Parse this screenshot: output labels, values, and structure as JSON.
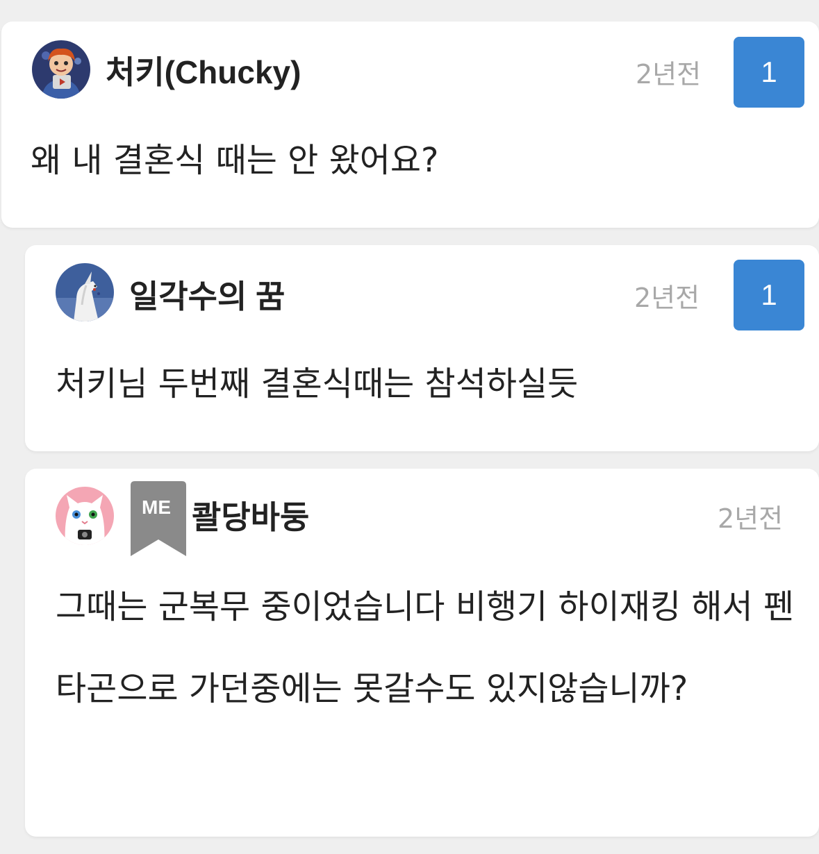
{
  "comments": [
    {
      "username": "처키(Chucky)",
      "time": "2년전",
      "votes": "1",
      "text": "왜 내 결혼식 때는 안 왔어요?"
    },
    {
      "username": "일각수의 꿈",
      "time": "2년전",
      "votes": "1",
      "text": "처키님 두번째 결혼식때는 참석하실듯"
    },
    {
      "username": "콸당바둥",
      "badge": "ME",
      "time": "2년전",
      "text": "그때는 군복무 중이었습니다 비행기 하이재킹 해서 펜타곤으로 가던중에는 못갈수도 있지않습니까?"
    }
  ],
  "colors": {
    "vote_bg": "#3a86d4",
    "badge_bg": "#8a8a8a",
    "time": "#a8a8a8",
    "background": "#efefef"
  },
  "icons": {
    "avatar_1": "chucky-doll-avatar",
    "avatar_2": "unicorn-avatar",
    "avatar_3": "white-cat-avatar",
    "badge": "bookmark-ribbon-icon"
  }
}
